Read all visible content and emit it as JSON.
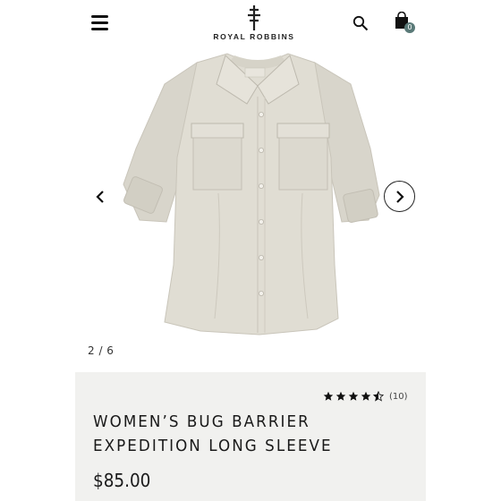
{
  "header": {
    "brand": "ROYAL ROBBINS",
    "cart_count": "0",
    "icons": {
      "menu": "hamburger-menu-icon",
      "search": "search-icon",
      "cart": "shopping-bag-icon",
      "logo": "tree-logo-icon"
    }
  },
  "gallery": {
    "counter": "2 / 6",
    "current_index": 2,
    "total": 6,
    "image_icon": "shirt-product-image",
    "prev_icon": "chevron-left-icon",
    "next_icon": "chevron-right-icon"
  },
  "product": {
    "rating": 4.5,
    "rating_max": 5,
    "review_count": "(10)",
    "title": "WOMEN’S BUG BARRIER EXPEDITION LONG SLEEVE",
    "price": "$85.00"
  },
  "colors": {
    "badge": "#5a7a78",
    "info_background": "#f1f1ef",
    "shirt": "#dedbd1",
    "text": "#1a1a1a"
  }
}
